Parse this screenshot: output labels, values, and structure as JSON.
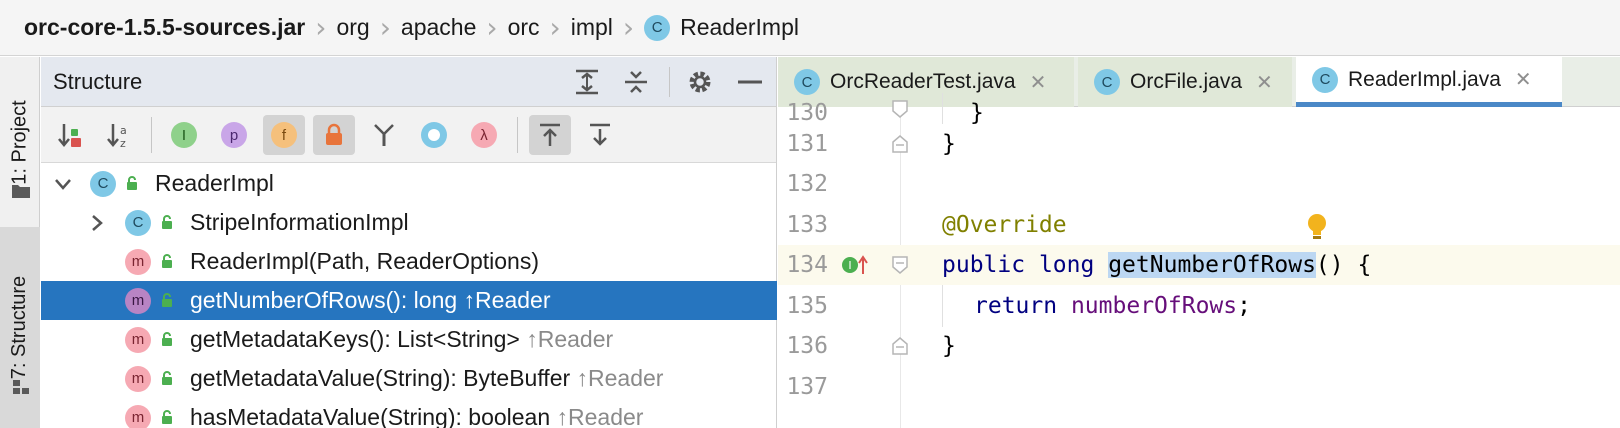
{
  "breadcrumb": {
    "items": [
      "orc-core-1.5.5-sources.jar",
      "org",
      "apache",
      "orc",
      "impl",
      "ReaderImpl"
    ],
    "class_icon_letter": "C"
  },
  "toolstrip": {
    "project_label": "1: Project",
    "structure_label": "7: Structure"
  },
  "structure": {
    "title": "Structure",
    "toolbar_letters": {
      "interface": "I",
      "property": "p",
      "field": "f",
      "lambda": "λ"
    },
    "tree": [
      {
        "name": "ReaderImpl",
        "icon": "C",
        "expanded": true
      },
      {
        "name": "StripeInformationImpl",
        "icon": "C",
        "expanded": false
      },
      {
        "name": "ReaderImpl(Path, ReaderOptions)",
        "icon": "m",
        "inherit": ""
      },
      {
        "name": "getNumberOfRows(): long",
        "icon": "m",
        "inherit": "↑Reader",
        "selected": true
      },
      {
        "name": "getMetadataKeys(): List<String>",
        "icon": "m",
        "inherit": "↑Reader"
      },
      {
        "name": "getMetadataValue(String): ByteBuffer",
        "icon": "m",
        "inherit": "↑Reader"
      },
      {
        "name": "hasMetadataValue(String): boolean",
        "icon": "m",
        "inherit": "↑Reader"
      }
    ]
  },
  "editor": {
    "tabs": [
      {
        "label": "OrcReaderTest.java",
        "icon": "C",
        "active": false
      },
      {
        "label": "OrcFile.java",
        "icon": "C",
        "active": false
      },
      {
        "label": "ReaderImpl.java",
        "icon": "C",
        "active": true
      }
    ],
    "close_glyph": "✕",
    "lines": [
      {
        "no": "130",
        "text": "}"
      },
      {
        "no": "131",
        "text": "}"
      },
      {
        "no": "132",
        "text": ""
      },
      {
        "no": "133",
        "annotation": "@Override"
      },
      {
        "no": "134",
        "kw1": "public",
        "kw2": "long",
        "method": "getNumberOfRows",
        "rest": "() {"
      },
      {
        "no": "135",
        "kw": "return",
        "field": "numberOfRows",
        "rest": ";"
      },
      {
        "no": "136",
        "text": "}"
      },
      {
        "no": "137",
        "text": ""
      }
    ],
    "gutter_marker_letter": "I"
  },
  "colors": {
    "selection": "#2675bf",
    "class_icon": "#7fc8e6",
    "method_icon": "#f6a9b3",
    "keyword": "#000080",
    "annotation": "#808000",
    "field": "#660e7a",
    "highlight": "#bcd7f2"
  }
}
